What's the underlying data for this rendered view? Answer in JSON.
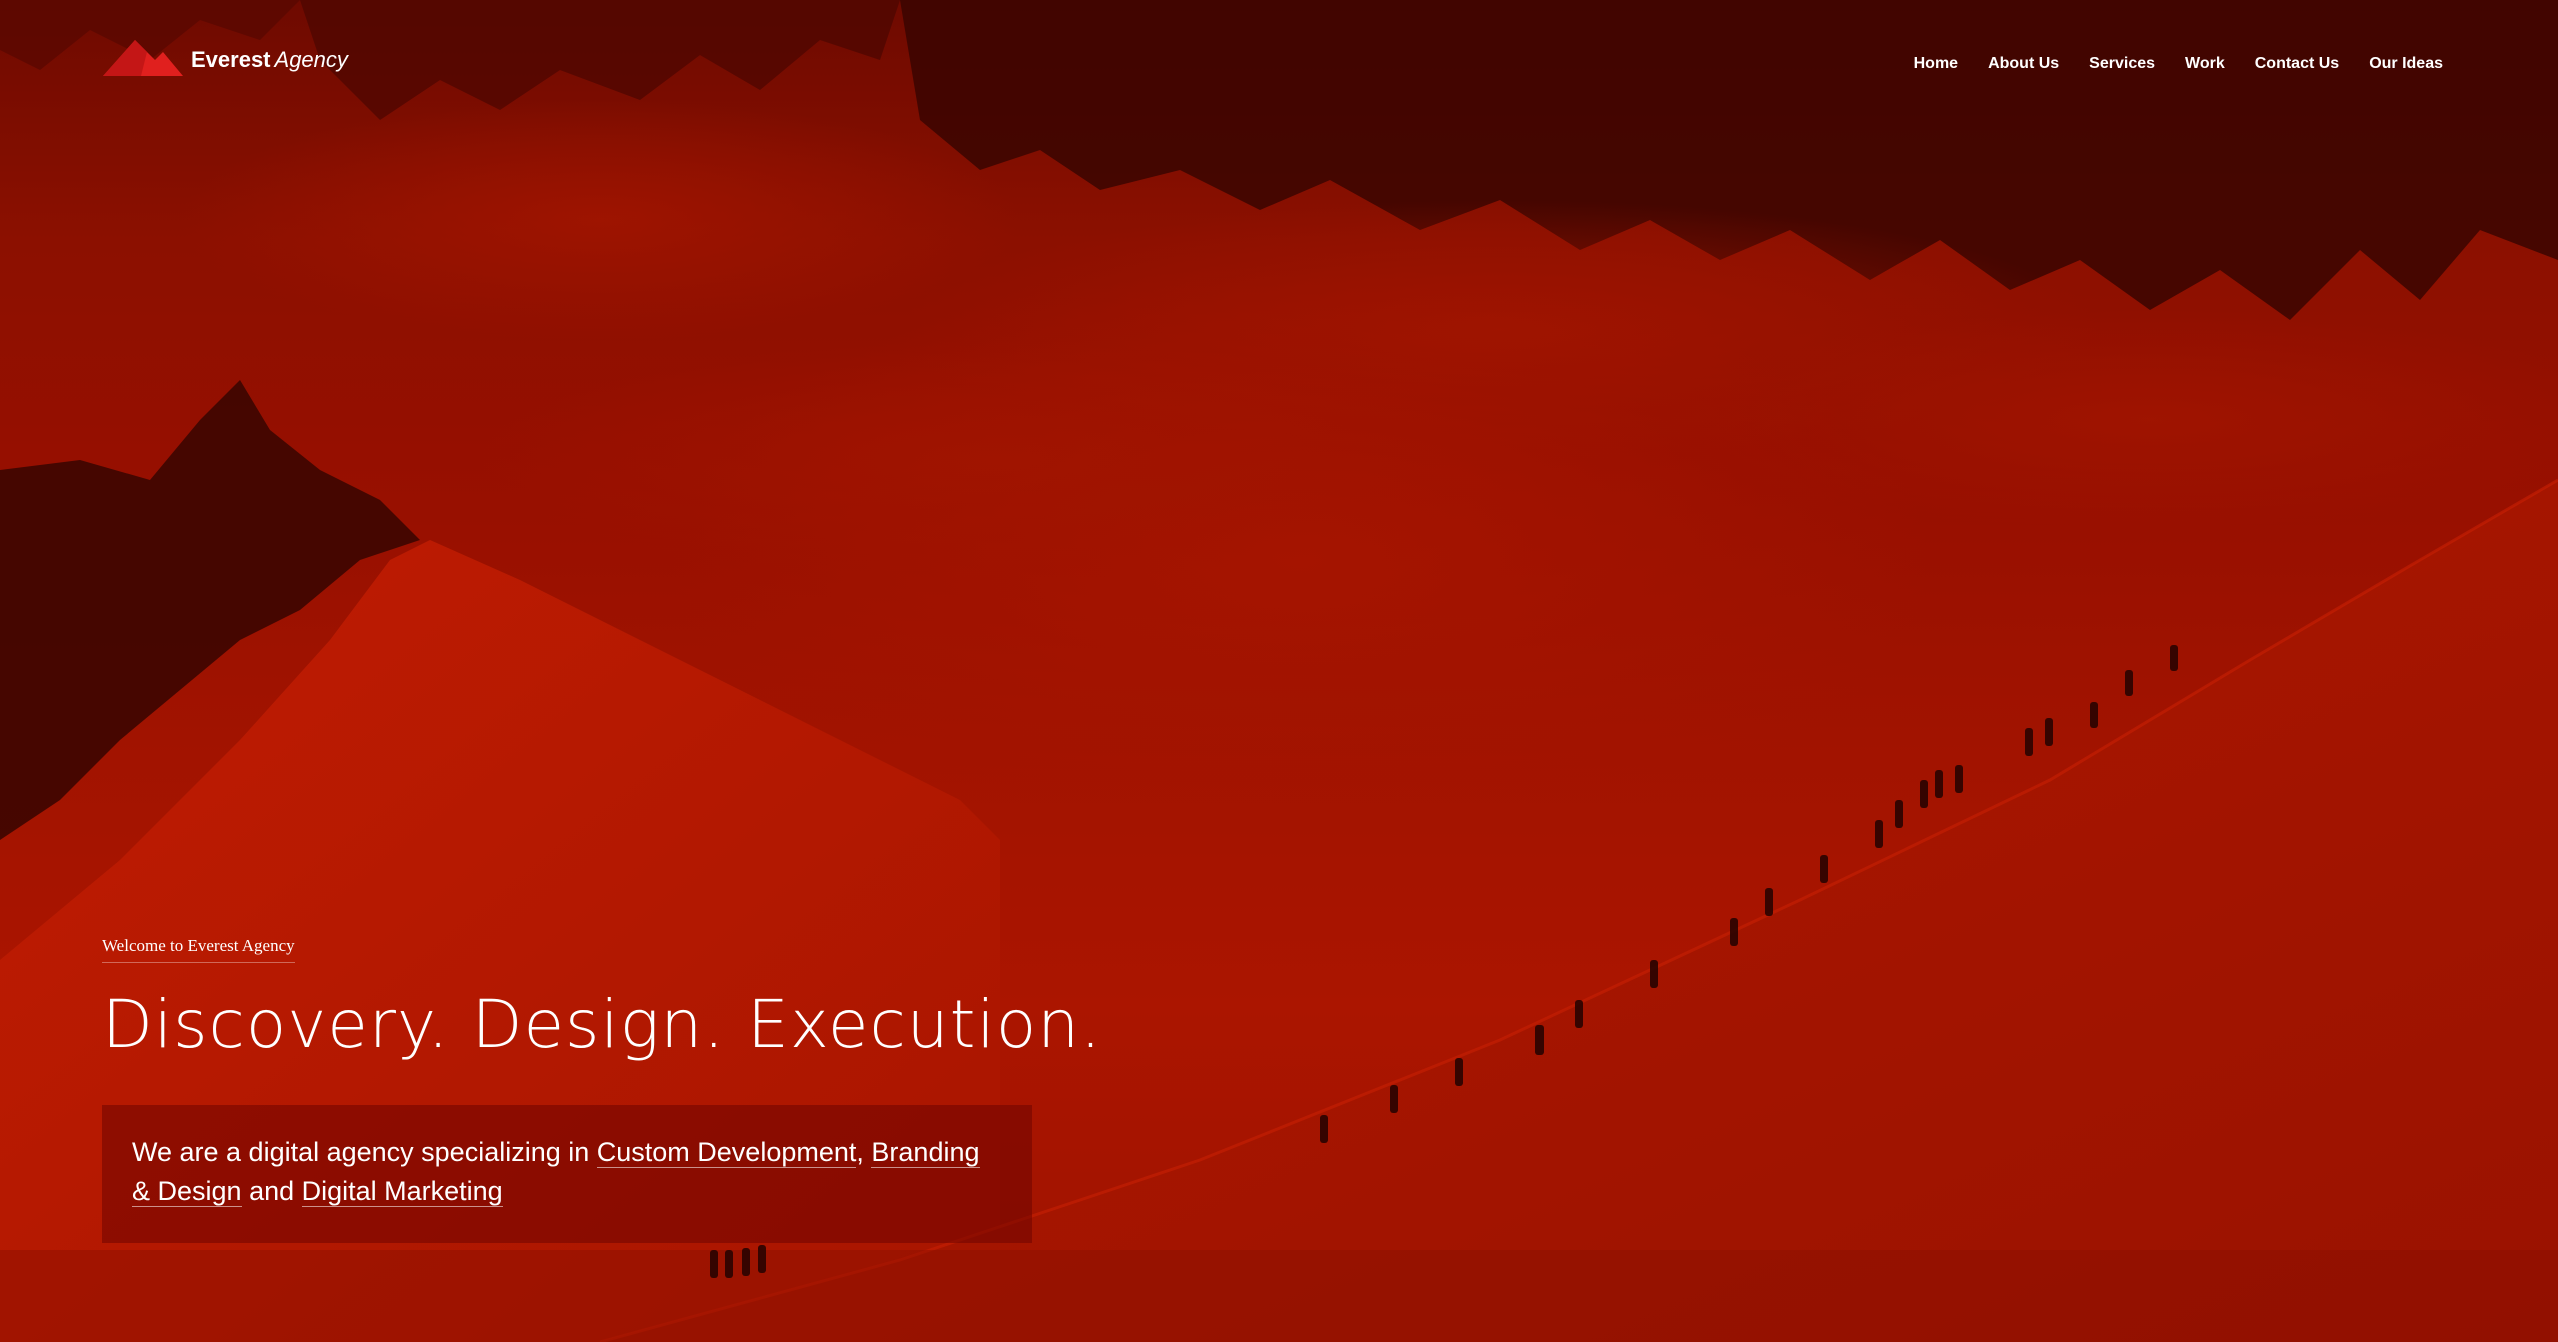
{
  "brand": {
    "name": "Everest",
    "suffix": "Agency",
    "logo_icon": "mountain-peak-icon",
    "logo_color": "#e0201e"
  },
  "nav": {
    "items": [
      "Home",
      "About Us",
      "Services",
      "Work",
      "Contact Us",
      "Our Ideas"
    ]
  },
  "hero": {
    "eyebrow": "Welcome to Everest Agency",
    "headline": "Discovery. Design. Execution.",
    "intro_prefix": "We are a digital agency specializing in ",
    "service_1": "Custom Development",
    "sep_1": ", ",
    "service_2": "Branding & Design",
    "sep_2": " and ",
    "service_3": "Digital Marketing",
    "background_image": "red-tinted-mountain-climbers-photo"
  },
  "colors": {
    "overlay_red": "#9e1300",
    "dark_red": "#6e0a00",
    "text": "#ffffff"
  }
}
